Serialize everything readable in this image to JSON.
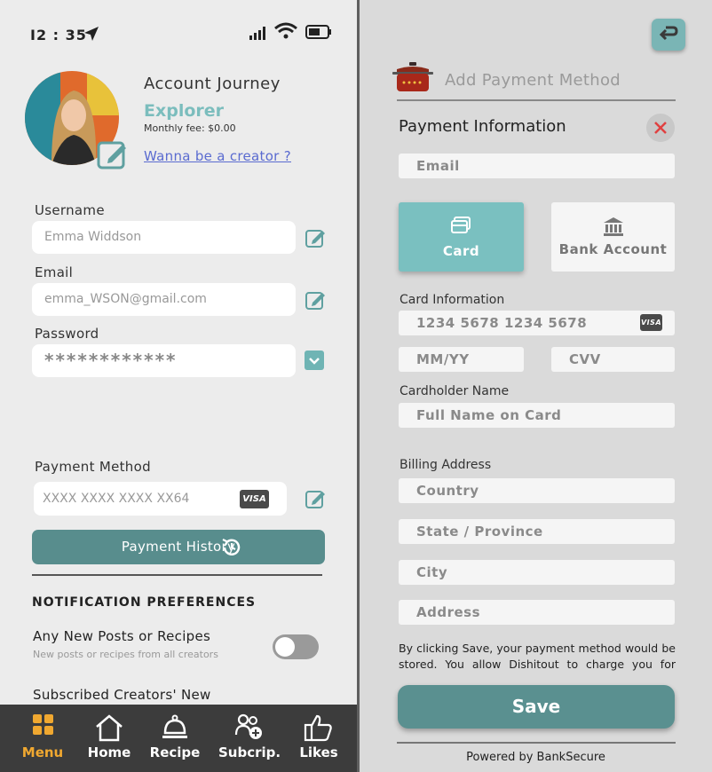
{
  "status_bar": {
    "time": "I2 : 35"
  },
  "profile": {
    "title": "Account Journey",
    "tier": "Explorer",
    "fee": "Monthly fee: $0.00",
    "creator_link": "Wanna be a creator ?"
  },
  "form": {
    "username_label": "Username",
    "username_value": "Emma Widdson",
    "email_label": "Email",
    "email_value": "emma_WSON@gmail.com",
    "password_label": "Password",
    "password_value": "************",
    "payment_label": "Payment Method",
    "payment_value": "XXXX XXXX XXXX XX64",
    "visa": "VISA",
    "history_button": "Payment History"
  },
  "notifications": {
    "header": "NOTIFICATION PREFERENCES",
    "items": [
      {
        "title": "Any New Posts or Recipes",
        "subtitle": "New posts or recipes from all creators",
        "enabled": false
      },
      {
        "title": "Subscribed Creators' New"
      }
    ]
  },
  "bottom_nav": {
    "items": [
      {
        "label": "Menu",
        "icon": "grid-icon",
        "active": true
      },
      {
        "label": "Home",
        "icon": "home-icon"
      },
      {
        "label": "Recipe",
        "icon": "cloche-icon"
      },
      {
        "label": "Subcrip.",
        "icon": "users-add-icon"
      },
      {
        "label": "Likes",
        "icon": "thumbs-up-icon"
      }
    ]
  },
  "payment_panel": {
    "title": "Add Payment Method",
    "section_title": "Payment Information",
    "email_placeholder": "Email",
    "tabs": [
      {
        "label": "Card",
        "icon": "card-icon",
        "selected": true
      },
      {
        "label": "Bank Account",
        "icon": "bank-icon",
        "selected": false
      }
    ],
    "card_info_label": "Card Information",
    "card_number_placeholder": "1234 5678 1234 5678",
    "visa": "VISA",
    "expiry_placeholder": "MM/YY",
    "cvv_placeholder": "CVV",
    "cardholder_label": "Cardholder Name",
    "cardholder_placeholder": "Full Name on Card",
    "billing_label": "Billing Address",
    "country_placeholder": "Country",
    "state_placeholder": "State / Province",
    "city_placeholder": "City",
    "address_placeholder": "Address",
    "consent": "By clicking Save, your payment method would be stored. You allow Dishitout to charge you for future",
    "save_button": "Save",
    "powered_by": "Powered by BankSecure"
  },
  "colors": {
    "accent_teal": "#7ac0c0",
    "dark_teal": "#588d8d",
    "link_blue": "#5a6bd0",
    "nav_active": "#f0a830",
    "close_red": "#e04040"
  }
}
